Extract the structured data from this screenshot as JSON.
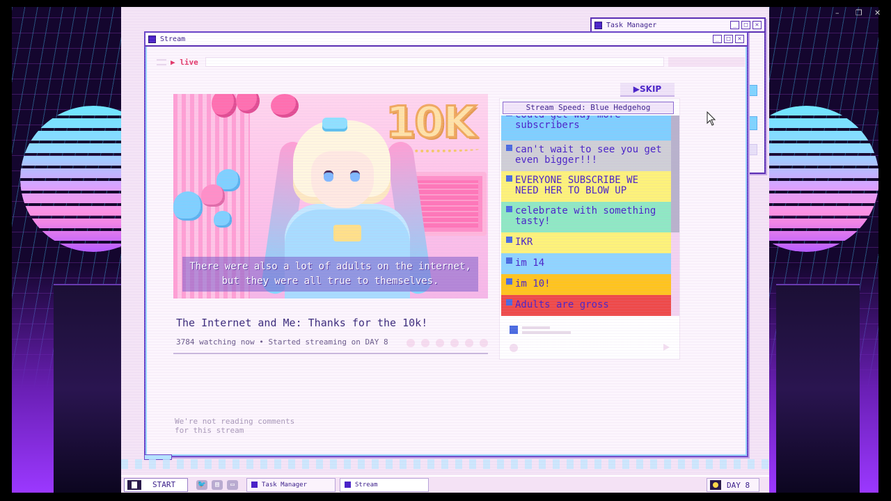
{
  "host_controls": {
    "minimize": "–",
    "restore": "❐",
    "close": "✕"
  },
  "task_manager_window": {
    "title": "Task Manager",
    "buttons": [
      "_",
      "□",
      "✕"
    ]
  },
  "stream_window": {
    "title": "Stream",
    "buttons": [
      "_",
      "□",
      "✕"
    ],
    "live_label": "▶ live",
    "skip_label": "▶SKIP",
    "video": {
      "overlay_text": "10K",
      "subtitle_line1": "There were also a lot of adults on the internet,",
      "subtitle_line2": "but they were all true to themselves."
    },
    "stream_title": "The Internet and Me: Thanks for the 10k!",
    "meta": "3784 watching now • Started streaming on DAY 8",
    "no_comments_line1": "We're not reading comments",
    "no_comments_line2": "for this stream",
    "chat": {
      "speed_label": "Stream Speed: Blue Hedgehog",
      "messages": [
        {
          "text": "could get way more subscribers",
          "color": "#7fcfff"
        },
        {
          "text": "can't wait to see you get even bigger!!!",
          "color": "#cfcfd6"
        },
        {
          "text": "EVERYONE SUBSCRIBE WE NEED HER TO BLOW UP",
          "color": "#fdf27a"
        },
        {
          "text": "celebrate with something tasty!",
          "color": "#8fe8c4"
        },
        {
          "text": "IKR",
          "color": "#fdf27a"
        },
        {
          "text": "im 14",
          "color": "#8fd4ff"
        },
        {
          "text": "im 10!",
          "color": "#ffc41e"
        },
        {
          "text": "Adults are gross",
          "color": "#ee4a4a"
        }
      ]
    }
  },
  "taskbar": {
    "start_label": "START",
    "tray_icons": [
      "twitter-icon",
      "chat-icon",
      "monitor-icon"
    ],
    "tasks": [
      "Task Manager",
      "Stream"
    ],
    "day_label": "DAY 8"
  },
  "colors": {
    "accent": "#4a23c8",
    "window_border": "#5b2fb4",
    "live": "#e2386a"
  }
}
